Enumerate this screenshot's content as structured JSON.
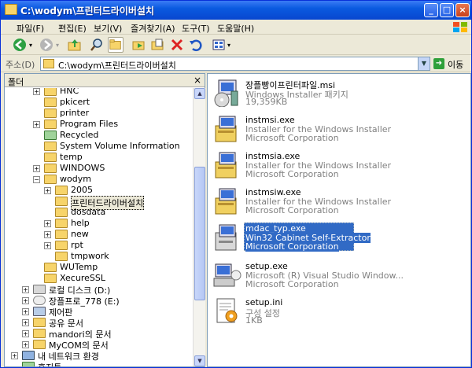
{
  "window": {
    "title": "C:\\wodym\\프린터드라이버설치"
  },
  "menu": [
    "파일(F)",
    "편집(E)",
    "보기(V)",
    "즐겨찾기(A)",
    "도구(T)",
    "도움말(H)"
  ],
  "address": {
    "label": "주소(D)",
    "value": "C:\\wodym\\프린터드라이버설치",
    "go_label": "이동"
  },
  "folders_pane": {
    "title": "폴더",
    "close": "×"
  },
  "tree": [
    {
      "label": "HNC",
      "level": 2,
      "expander": "+",
      "icon": "folder"
    },
    {
      "label": "pkicert",
      "level": 2,
      "expander": "",
      "icon": "folder"
    },
    {
      "label": "printer",
      "level": 2,
      "expander": "",
      "icon": "folder"
    },
    {
      "label": "Program Files",
      "level": 2,
      "expander": "+",
      "icon": "folder"
    },
    {
      "label": "Recycled",
      "level": 2,
      "expander": "",
      "icon": "recycle"
    },
    {
      "label": "System Volume Information",
      "level": 2,
      "expander": "",
      "icon": "folder"
    },
    {
      "label": "temp",
      "level": 2,
      "expander": "",
      "icon": "folder"
    },
    {
      "label": "WINDOWS",
      "level": 2,
      "expander": "+",
      "icon": "folder"
    },
    {
      "label": "wodym",
      "level": 2,
      "expander": "−",
      "icon": "folder"
    },
    {
      "label": "2005",
      "level": 3,
      "expander": "+",
      "icon": "folder"
    },
    {
      "label": "프린터드라이버설치",
      "level": 3,
      "expander": "",
      "icon": "folder",
      "selected": true
    },
    {
      "label": "dosdata",
      "level": 3,
      "expander": "",
      "icon": "folder"
    },
    {
      "label": "help",
      "level": 3,
      "expander": "+",
      "icon": "folder"
    },
    {
      "label": "new",
      "level": 3,
      "expander": "+",
      "icon": "folder"
    },
    {
      "label": "rpt",
      "level": 3,
      "expander": "+",
      "icon": "folder"
    },
    {
      "label": "tmpwork",
      "level": 3,
      "expander": "",
      "icon": "folder"
    },
    {
      "label": "WUTemp",
      "level": 2,
      "expander": "",
      "icon": "folder"
    },
    {
      "label": "XecureSSL",
      "level": 2,
      "expander": "",
      "icon": "folder"
    },
    {
      "label": "로컬 디스크 (D:)",
      "level": 1,
      "expander": "+",
      "icon": "drive"
    },
    {
      "label": "장플프로_778 (E:)",
      "level": 1,
      "expander": "+",
      "icon": "cd"
    },
    {
      "label": "제어판",
      "level": 1,
      "expander": "+",
      "icon": "ctrl"
    },
    {
      "label": "공유 문서",
      "level": 1,
      "expander": "+",
      "icon": "folder"
    },
    {
      "label": "mandori의 문서",
      "level": 1,
      "expander": "+",
      "icon": "folder"
    },
    {
      "label": "MyCOM의 문서",
      "level": 1,
      "expander": "+",
      "icon": "folder"
    },
    {
      "label": "내 네트워크 환경",
      "level": 0,
      "expander": "+",
      "icon": "net"
    },
    {
      "label": "휴지통",
      "level": 0,
      "expander": "",
      "icon": "recycle"
    }
  ],
  "files": [
    {
      "name": "장플빵이프린터파일.msi",
      "desc": "Windows Installer 패키지",
      "meta": "19,359KB",
      "icon": "msi-icon"
    },
    {
      "name": "instmsi.exe",
      "desc": "Installer for the Windows Installer",
      "meta": "Microsoft Corporation",
      "icon": "installer-icon"
    },
    {
      "name": "instmsia.exe",
      "desc": "Installer for the Windows Installer",
      "meta": "Microsoft Corporation",
      "icon": "installer-icon"
    },
    {
      "name": "instmsiw.exe",
      "desc": "Installer for the Windows Installer",
      "meta": "Microsoft Corporation",
      "icon": "installer-icon"
    },
    {
      "name": "mdac_typ.exe",
      "desc": "Win32 Cabinet Self-Extractor",
      "meta": "Microsoft Corporation",
      "icon": "cabinet-icon",
      "selected": true
    },
    {
      "name": "setup.exe",
      "desc": "Microsoft (R) Visual Studio Window...",
      "meta": "Microsoft Corporation",
      "icon": "setup-icon"
    },
    {
      "name": "setup.ini",
      "desc": "구성 설정",
      "meta": "1KB",
      "icon": "ini-icon"
    }
  ],
  "colors": {
    "titlebar": "#0a5ae0",
    "selection": "#316ac5",
    "chrome": "#ece9d8"
  }
}
